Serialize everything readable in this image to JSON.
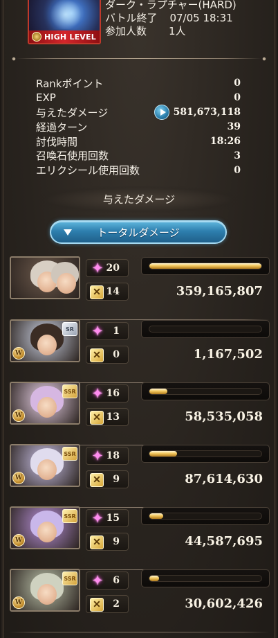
{
  "quest": {
    "title": "ダーク・ラプチャー(HARD)",
    "battle_end_label": "バトル終了",
    "battle_end_time": "07/05 18:31",
    "participants_label": "参加人数",
    "participants_value": "1人",
    "badge_label": "HIGH LEVEL"
  },
  "stats": [
    {
      "label": "Rankポイント",
      "value": "0"
    },
    {
      "label": "EXP",
      "value": "0"
    },
    {
      "label": "与えたダメージ",
      "value": "581,673,118",
      "has_play_icon": true
    },
    {
      "label": "経過ターン",
      "value": "39"
    },
    {
      "label": "討伐時間",
      "value": "18:26"
    },
    {
      "label": "召喚石使用回数",
      "value": "3"
    },
    {
      "label": "エリクシール使用回数",
      "value": "0"
    }
  ],
  "section_title": "与えたダメージ",
  "dropdown": {
    "label": "トータルダメージ"
  },
  "characters": [
    {
      "rarity": "",
      "element": "",
      "skill_count": "20",
      "ability_count": "14",
      "damage": "359,165,807",
      "damage_fraction": 1.0,
      "portrait_hue": "#6d5a4c"
    },
    {
      "rarity": "SR",
      "element": "W",
      "skill_count": "1",
      "ability_count": "0",
      "damage": "1,167,502",
      "damage_fraction": 0.003,
      "portrait_hue": "#c9cfe0"
    },
    {
      "rarity": "SSR",
      "element": "W",
      "skill_count": "16",
      "ability_count": "13",
      "damage": "58,535,058",
      "damage_fraction": 0.163,
      "portrait_hue": "#e9d2e8"
    },
    {
      "rarity": "SSR",
      "element": "W",
      "skill_count": "18",
      "ability_count": "9",
      "damage": "87,614,630",
      "damage_fraction": 0.244,
      "portrait_hue": "#c8c0e6"
    },
    {
      "rarity": "SSR",
      "element": "W",
      "skill_count": "15",
      "ability_count": "9",
      "damage": "44,587,695",
      "damage_fraction": 0.124,
      "portrait_hue": "#b790d8"
    },
    {
      "rarity": "SSR",
      "element": "W",
      "skill_count": "6",
      "ability_count": "2",
      "damage": "30,602,426",
      "damage_fraction": 0.085,
      "portrait_hue": "#b9c0a8"
    }
  ],
  "colors": {
    "accent_blue": "#2e7fae",
    "bar_gold": "#f3c85e",
    "sparkle_pink": "#ff8cf0"
  }
}
